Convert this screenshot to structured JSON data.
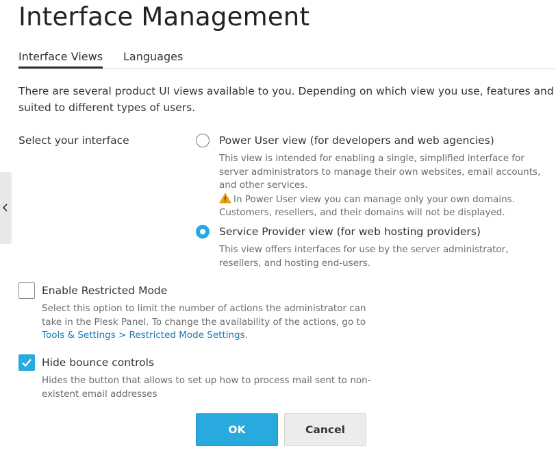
{
  "page": {
    "title": "Interface Management"
  },
  "tabs": [
    {
      "label": "Interface Views",
      "active": true
    },
    {
      "label": "Languages",
      "active": false
    }
  ],
  "intro": "There are several product UI views available to you. Depending on which view you use, features and suited to different types of users.",
  "interface_select": {
    "label": "Select your interface",
    "options": [
      {
        "label": "Power User view (for developers and web agencies)",
        "description": "This view is intended for enabling a single, simplified interface for server administrators to manage their own websites, email accounts, and other services.",
        "warning": "In Power User view you can manage only your own domains. Customers, resellers, and their domains will not be displayed.",
        "selected": false
      },
      {
        "label": "Service Provider view (for web hosting providers)",
        "description": "This view offers interfaces for use by the server administrator, resellers, and hosting end-users.",
        "selected": true
      }
    ]
  },
  "restricted_mode": {
    "label": "Enable Restricted Mode",
    "checked": false,
    "description": "Select this option to limit the number of actions the administrator can take in the Plesk Panel. To change the availability of the actions, go to",
    "link_text": "Tools & Settings > Restricted Mode Settings",
    "after_link": "."
  },
  "bounce_controls": {
    "label": "Hide bounce controls",
    "checked": true,
    "description": "Hides the button that allows to set up how to process mail sent to non-existent email addresses"
  },
  "buttons": {
    "ok": "OK",
    "cancel": "Cancel"
  },
  "colors": {
    "accent": "#28aadf",
    "link": "#1a78b8",
    "warning": "#f0a30a"
  },
  "icons": {
    "side_handle": "chevron-left-icon",
    "warning": "warning-icon",
    "checkmark": "checkmark-icon"
  }
}
